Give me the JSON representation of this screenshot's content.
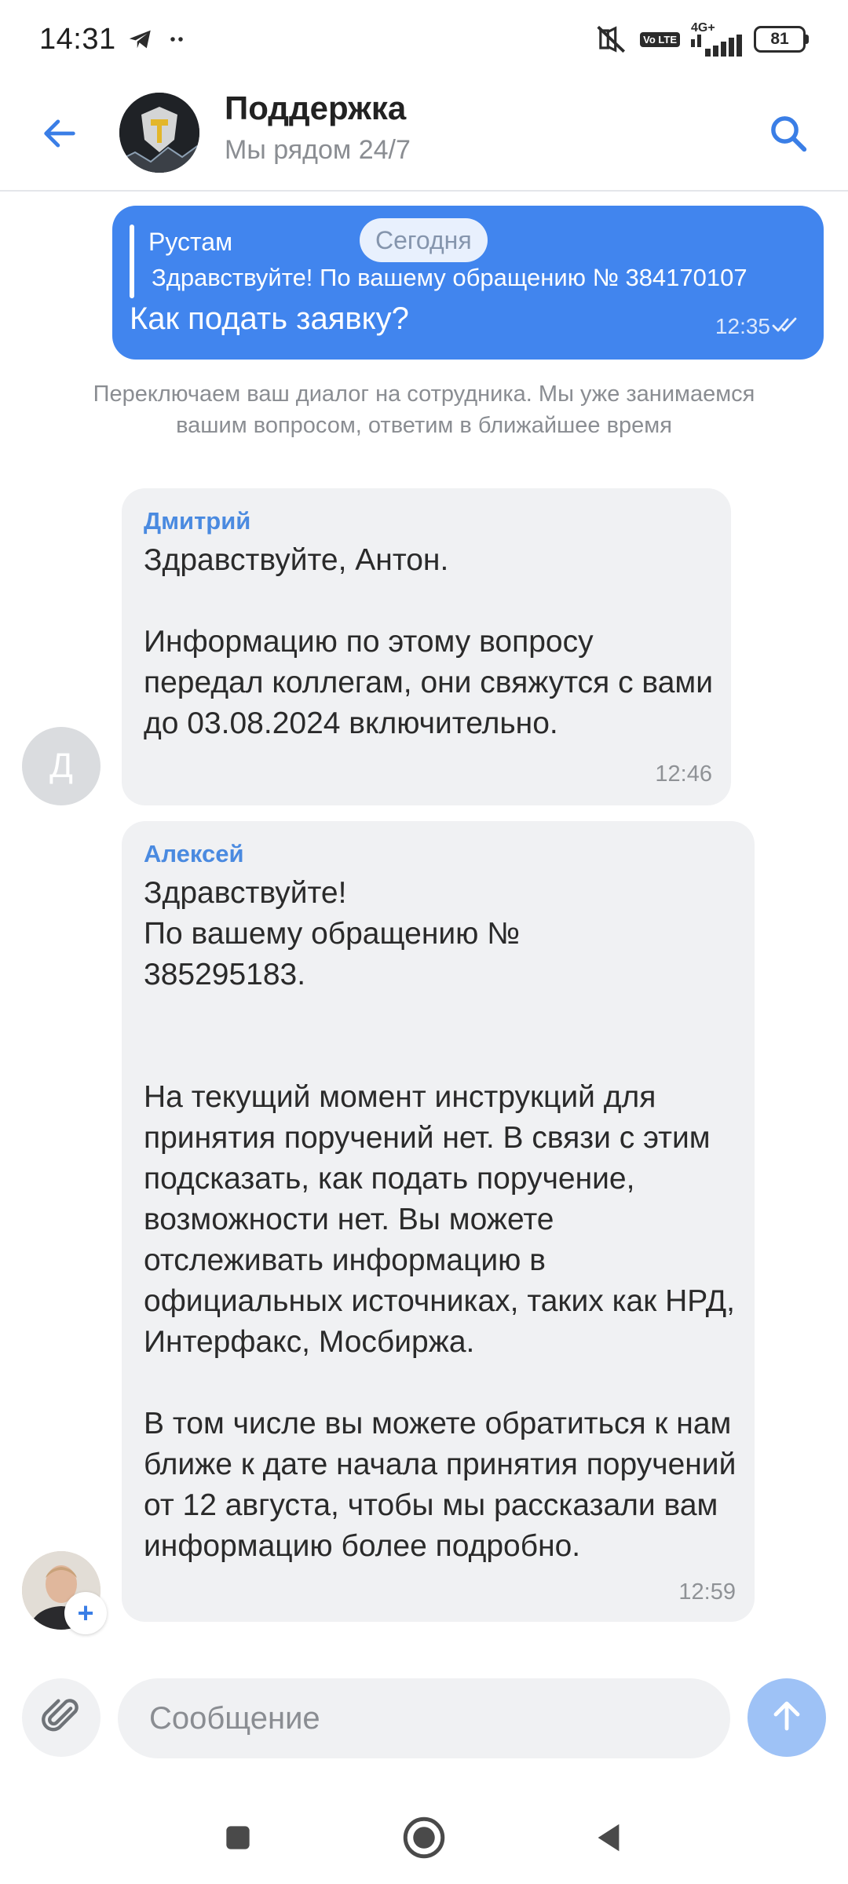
{
  "status_bar": {
    "time": "14:31",
    "icons": [
      "telegram-icon",
      "more-dots-icon",
      "mute-icon",
      "volte-icon",
      "signal-icon"
    ],
    "volte_label": "Vo LTE",
    "network": "4G+",
    "battery": "81"
  },
  "header": {
    "title": "Поддержка",
    "subtitle": "Мы рядом 24/7",
    "back_icon": "arrow-left-icon",
    "search_icon": "search-icon"
  },
  "chat": {
    "date_label": "Сегодня",
    "outgoing": {
      "reply_name": "Рустам",
      "reply_text": "Здравствуйте! По вашему обращению № 384170107",
      "text": "Как подать заявку?",
      "time": "12:35",
      "status_icon": "double-check-icon"
    },
    "system_message": "Переключаем ваш диалог на сотрудника. Мы уже занимаемся вашим вопросом, ответим в ближайшее время",
    "messages": [
      {
        "sender": "Дмитрий",
        "avatar_letter": "Д",
        "text": "Здравствуйте, Антон.\n\nИнформацию по этому вопросу передал коллегам, они свяжутся с вами до 03.08.2024 включительно.",
        "time": "12:46"
      },
      {
        "sender": "Алексей",
        "avatar_badge": "+",
        "text": "Здравствуйте!\nПо вашему обращению №\n385295183.\n\n\nНа текущий момент инструкций для принятия поручений нет. В связи с этим подсказать, как подать поручение, возможности нет. Вы можете отслеживать информацию в официальных источниках, таких как НРД, Интерфакс, Мосбиржа.\n\nВ том числе вы можете обратиться к нам ближе к дате начала принятия поручений от 12 августа, чтобы мы рассказали вам информацию более подробно.",
        "time": "12:59"
      }
    ]
  },
  "composer": {
    "placeholder": "Сообщение",
    "attach_icon": "paperclip-icon",
    "send_icon": "arrow-up-icon"
  },
  "nav": {
    "icons": [
      "recents-icon",
      "home-icon",
      "back-icon"
    ]
  },
  "colors": {
    "accent": "#4185ee",
    "bubble_incoming": "#f0f1f3",
    "sender_name": "#4a8ae0",
    "send_button": "#9ec2f6"
  }
}
